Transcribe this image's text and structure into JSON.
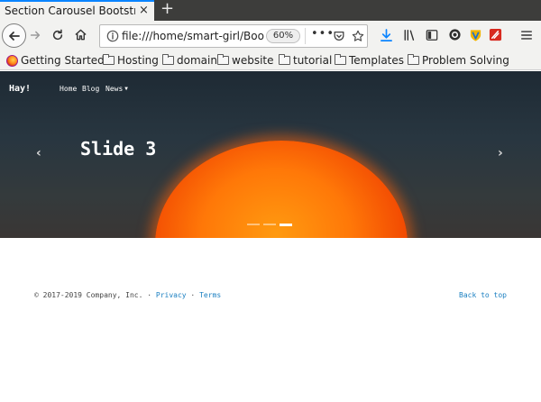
{
  "browser": {
    "tab": {
      "title": "Section Carousel Bootstrap",
      "close": "×"
    },
    "new_tab": "+",
    "url": "file:///home/smart-girl/Bootstrap",
    "zoom": "60%",
    "more": "•••",
    "bookmarks": [
      {
        "label": "Getting Started",
        "icon": "firefox-icon"
      },
      {
        "label": "Hosting",
        "icon": "folder-icon"
      },
      {
        "label": "domain",
        "icon": "folder-icon"
      },
      {
        "label": "website",
        "icon": "folder-icon"
      },
      {
        "label": "tutorial",
        "icon": "folder-icon"
      },
      {
        "label": "Templates",
        "icon": "folder-icon"
      },
      {
        "label": "Problem Solving",
        "icon": "folder-icon"
      }
    ]
  },
  "site": {
    "brand": "Hay!",
    "nav": [
      "Home",
      "Blog",
      "News"
    ],
    "carousel": {
      "caption": "Slide 3",
      "prev": "‹",
      "next": "›",
      "slide_count": 3,
      "active_slide": 3
    },
    "footer": {
      "copyright": "© 2017-2019 Company, Inc. ·",
      "privacy": "Privacy",
      "separator": "·",
      "terms": "Terms",
      "back_to_top": "Back to top"
    }
  },
  "colors": {
    "accent": "#0a84ff",
    "link": "#1a7fc1",
    "sun": "#ff7808"
  }
}
